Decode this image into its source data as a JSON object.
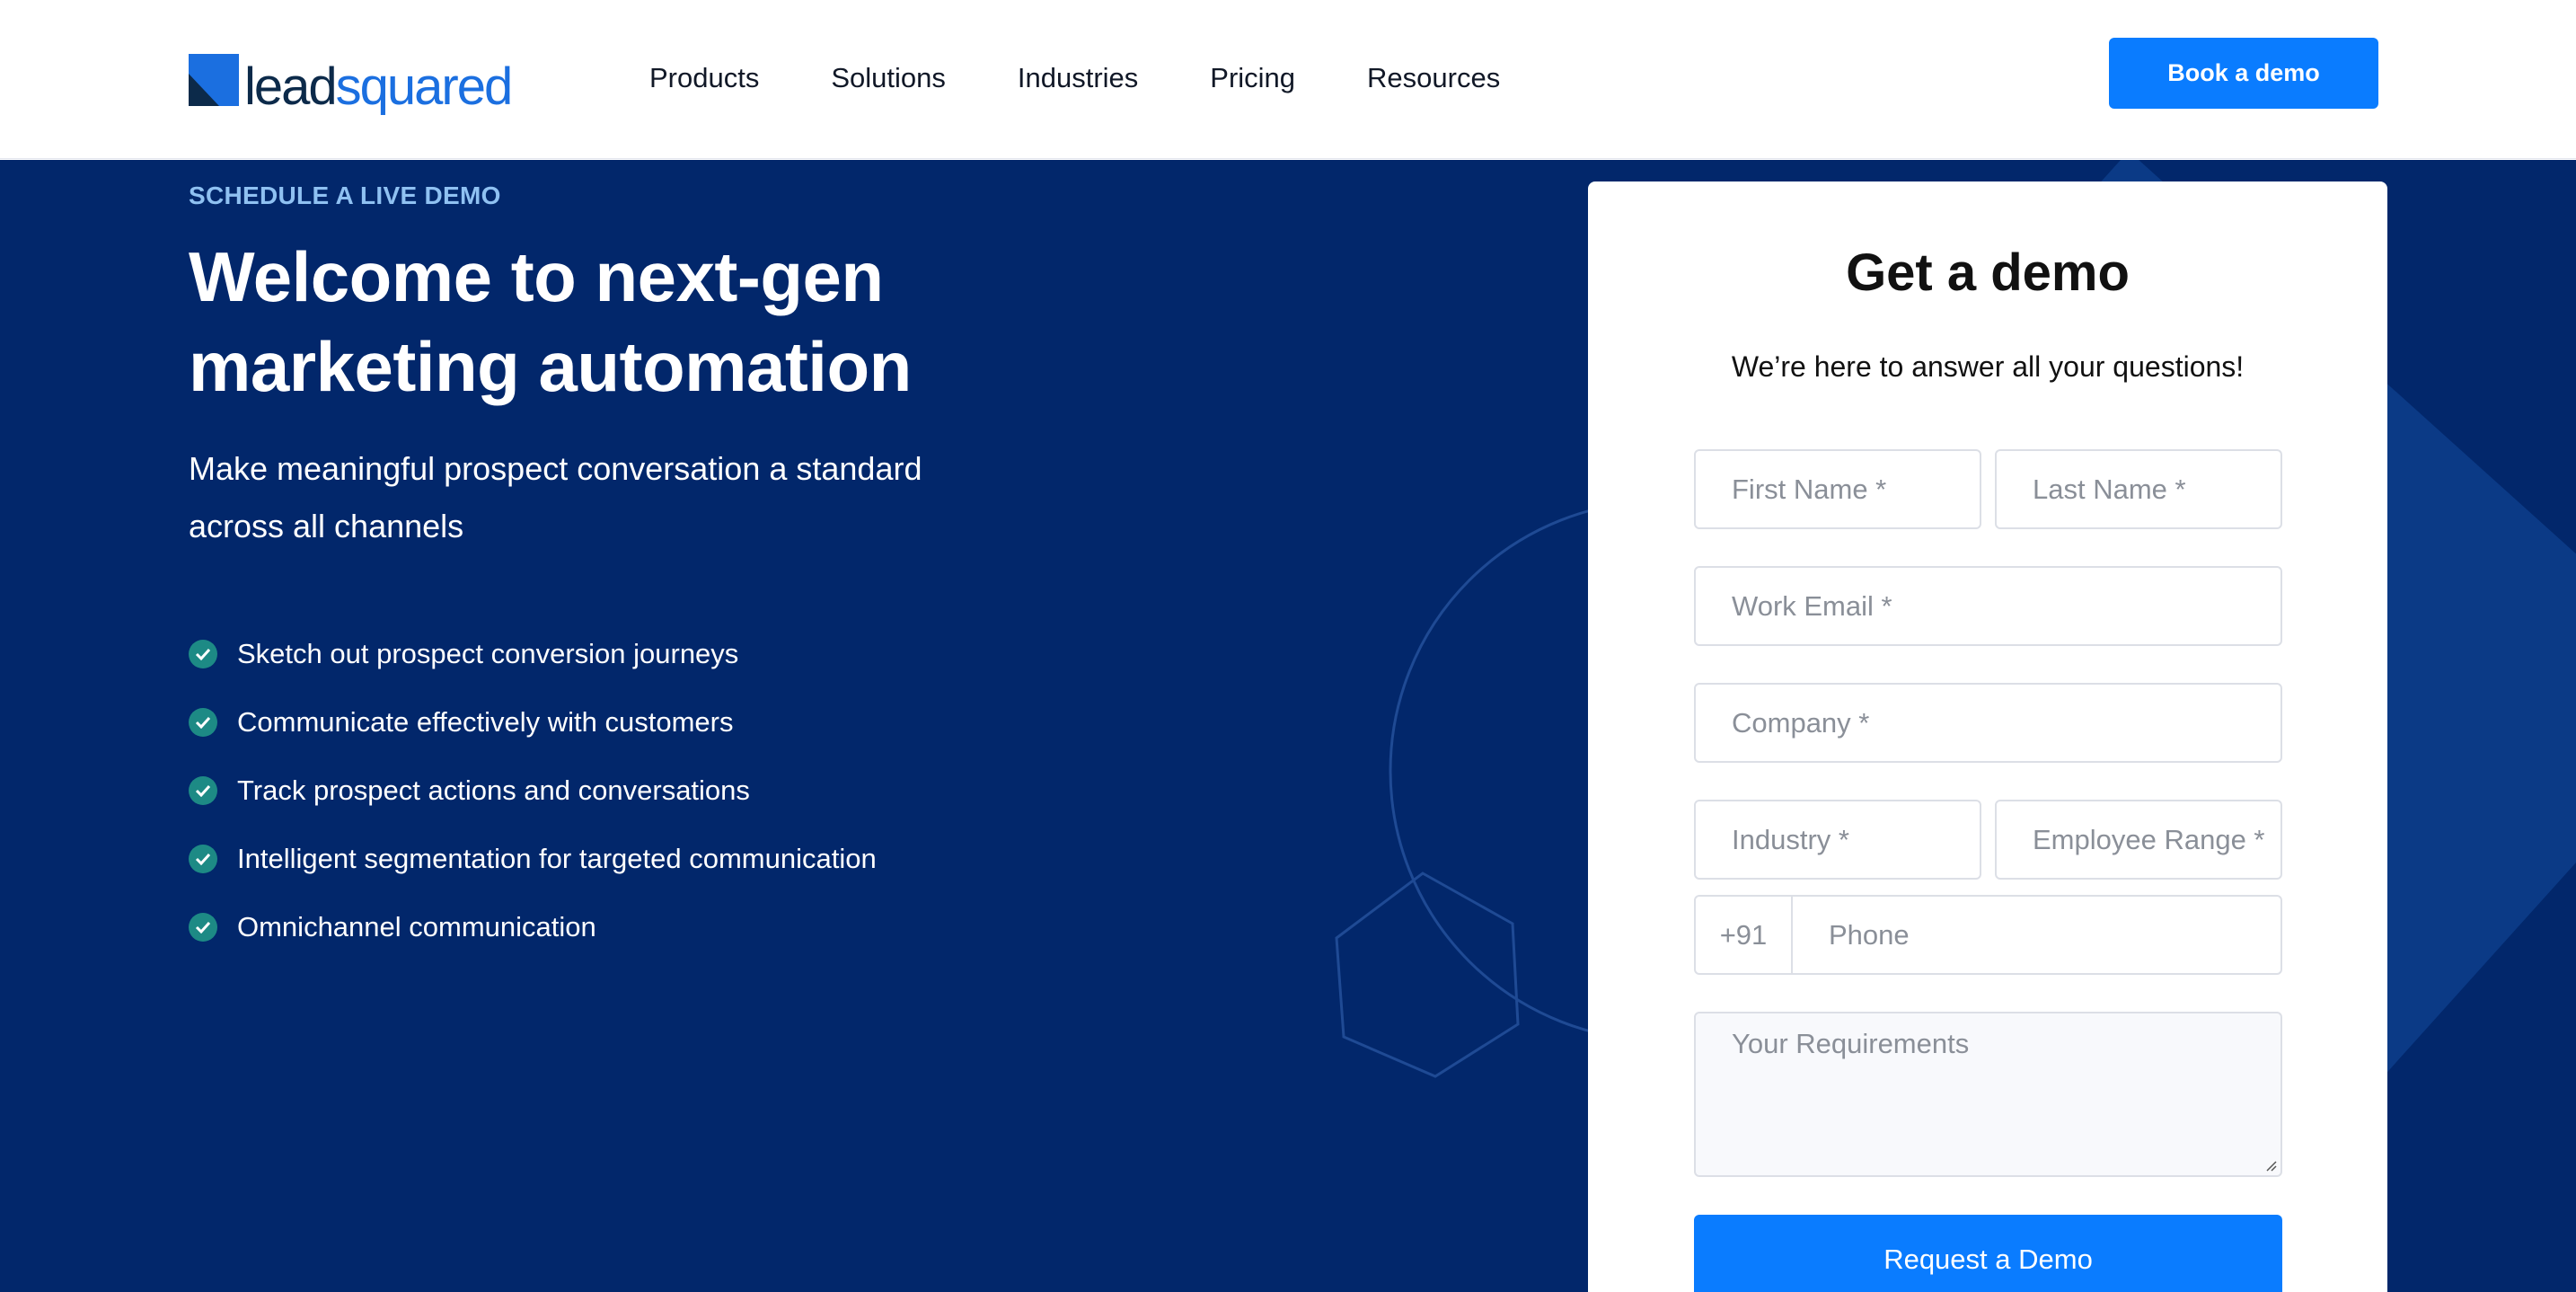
{
  "header": {
    "logo": {
      "part1": "lead",
      "part2": "squared"
    },
    "nav": [
      "Products",
      "Solutions",
      "Industries",
      "Pricing",
      "Resources"
    ],
    "cta": "Book a demo"
  },
  "hero": {
    "kicker": "SCHEDULE A LIVE DEMO",
    "headline_line1": "Welcome to next-gen",
    "headline_line2": "marketing automation",
    "subhead_line1": "Make meaningful prospect conversation a standard",
    "subhead_line2": "across all channels",
    "features": [
      "Sketch out prospect conversion journeys",
      "Communicate effectively with customers",
      "Track prospect actions and conversations",
      "Intelligent segmentation for targeted communication",
      "Omnichannel communication"
    ]
  },
  "form": {
    "title": "Get a demo",
    "subtitle": "We’re here to answer all your questions!",
    "first_name": "First Name *",
    "last_name": "Last Name *",
    "work_email": "Work Email *",
    "company": "Company *",
    "industry": "Industry *",
    "employee_range": "Employee Range *",
    "phone_code": "+91",
    "phone": "Phone",
    "requirements": "Your Requirements",
    "submit": "Request a Demo"
  },
  "colors": {
    "hero_bg": "#02276b",
    "accent": "#0a7cff",
    "kicker": "#8fc1f2",
    "check": "#1d8a85"
  }
}
